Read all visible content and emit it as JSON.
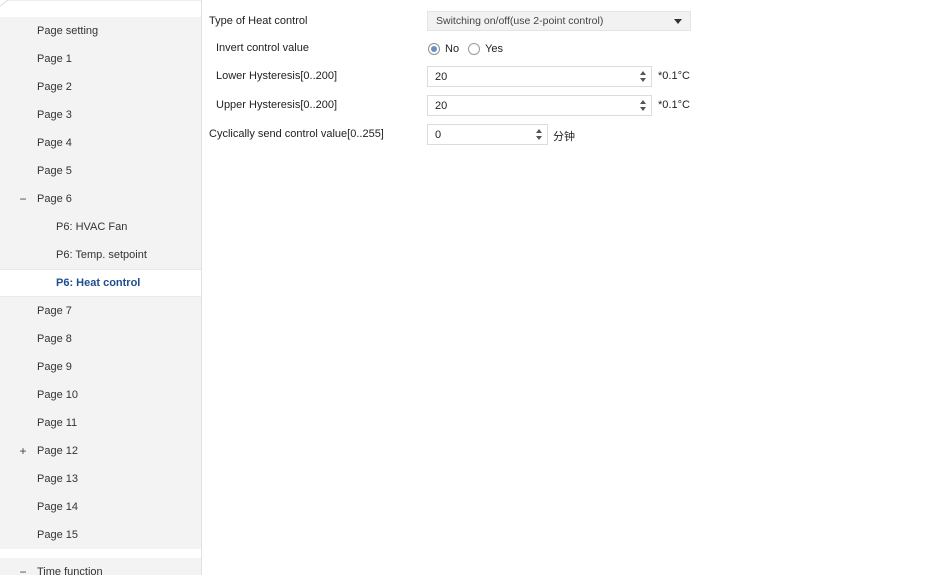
{
  "sidebar": {
    "items": [
      {
        "label": "Page setting",
        "level": 1,
        "toggle": ""
      },
      {
        "label": "Page 1",
        "level": 1,
        "toggle": ""
      },
      {
        "label": "Page 2",
        "level": 1,
        "toggle": ""
      },
      {
        "label": "Page 3",
        "level": 1,
        "toggle": ""
      },
      {
        "label": "Page 4",
        "level": 1,
        "toggle": ""
      },
      {
        "label": "Page 5",
        "level": 1,
        "toggle": ""
      },
      {
        "label": "Page 6",
        "level": 1,
        "toggle": "−"
      },
      {
        "label": "P6: HVAC Fan",
        "level": 2,
        "toggle": ""
      },
      {
        "label": "P6: Temp. setpoint",
        "level": 2,
        "toggle": ""
      },
      {
        "label": "P6: Heat control",
        "level": 2,
        "toggle": "",
        "selected": true
      },
      {
        "label": "Page 7",
        "level": 1,
        "toggle": ""
      },
      {
        "label": "Page 8",
        "level": 1,
        "toggle": ""
      },
      {
        "label": "Page 9",
        "level": 1,
        "toggle": ""
      },
      {
        "label": "Page 10",
        "level": 1,
        "toggle": ""
      },
      {
        "label": "Page 11",
        "level": 1,
        "toggle": ""
      },
      {
        "label": "Page 12",
        "level": 1,
        "toggle": "+"
      },
      {
        "label": "Page 13",
        "level": 1,
        "toggle": ""
      },
      {
        "label": "Page 14",
        "level": 1,
        "toggle": ""
      },
      {
        "label": "Page 15",
        "level": 1,
        "toggle": ""
      },
      {
        "label": "Time function",
        "level": 1,
        "toggle": "−"
      }
    ]
  },
  "params": {
    "heat_type": {
      "label": "Type of Heat control",
      "value": "Switching on/off(use 2-point control)"
    },
    "invert": {
      "label": "Invert control value",
      "options": [
        "No",
        "Yes"
      ],
      "selected": "No"
    },
    "lower_hyst": {
      "label": "Lower Hysteresis[0..200]",
      "value": "20",
      "unit": "*0.1°C"
    },
    "upper_hyst": {
      "label": "Upper Hysteresis[0..200]",
      "value": "20",
      "unit": "*0.1°C"
    },
    "cyclic": {
      "label": "Cyclically send control value[0..255]",
      "value": "0",
      "unit": "分钟"
    }
  },
  "colors": {
    "selected_text": "#1f4d8f",
    "radio_dot": "#6b8fc5",
    "sidebar_bg": "#f3f3f3"
  }
}
